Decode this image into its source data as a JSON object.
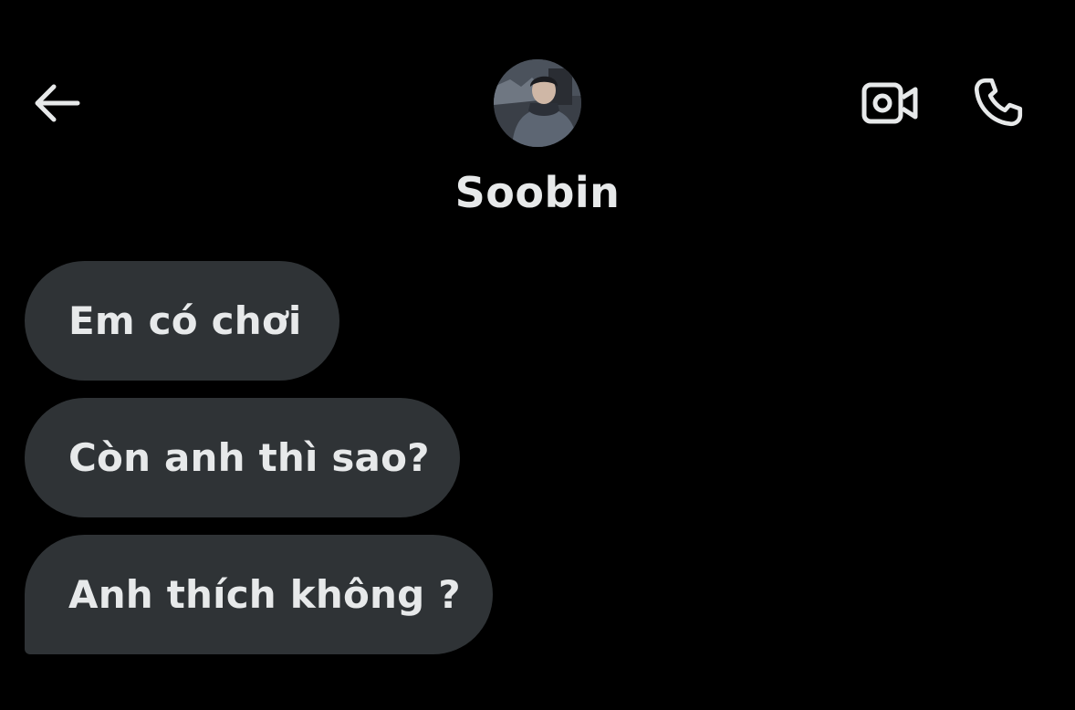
{
  "header": {
    "contact_name": "Soobin",
    "back_icon": "arrow-left-icon",
    "video_icon": "video-camera-icon",
    "call_icon": "phone-icon",
    "avatar_icon": "profile-photo"
  },
  "messages": [
    {
      "text": "Em có chơi",
      "direction": "incoming"
    },
    {
      "text": "Còn anh thì sao?",
      "direction": "incoming"
    },
    {
      "text": "Anh thích không ?",
      "direction": "incoming"
    }
  ],
  "timestamp": "",
  "colors": {
    "background": "#000000",
    "bubble": "#2f3336",
    "text": "#e7e9ea",
    "muted": "#71767b"
  }
}
